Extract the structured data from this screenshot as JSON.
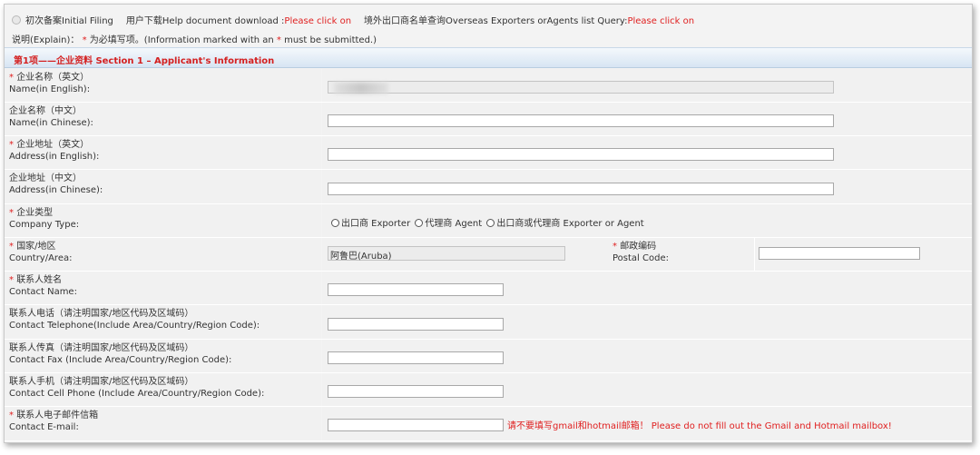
{
  "topbar": {
    "initial_filing": "初次备案Initial Filing",
    "help_label": "用户下载Help document download :",
    "help_link": "Please click on",
    "query_label": "境外出口商名单查询Overseas Exporters orAgents list Query:",
    "query_link": "Please click on"
  },
  "explain": {
    "prefix": "说明(Explain)：",
    "star": "*",
    "mid": "为必填写项。(Information marked with an",
    "star2": "*",
    "suffix": "must be submitted.)"
  },
  "section": {
    "title": "第1项——企业资料 Section 1 – Applicant's Information"
  },
  "fields": {
    "name_en": {
      "required": "*",
      "cn": "企业名称（英文）",
      "en": "Name(in English):"
    },
    "name_cn": {
      "cn": "企业名称（中文）",
      "en": "Name(in Chinese):"
    },
    "addr_en": {
      "required": "*",
      "cn": "企业地址（英文）",
      "en": "Address(in English):"
    },
    "addr_cn": {
      "cn": "企业地址（中文）",
      "en": "Address(in Chinese):"
    },
    "company_type": {
      "required": "*",
      "cn": "企业类型",
      "en": "Company Type:",
      "options": [
        "出口商 Exporter",
        "代理商 Agent",
        "出口商或代理商 Exporter or Agent"
      ]
    },
    "country": {
      "required": "*",
      "cn": "国家/地区",
      "en": "Country/Area:",
      "value": "阿鲁巴(Aruba)"
    },
    "postal": {
      "required": "*",
      "cn": "邮政编码",
      "en": "Postal Code:"
    },
    "contact_name": {
      "required": "*",
      "cn": "联系人姓名",
      "en": "Contact Name:"
    },
    "contact_tel": {
      "cn": "联系人电话（请注明国家/地区代码及区域码）",
      "en": "Contact Telephone(Include Area/Country/Region Code):"
    },
    "contact_fax": {
      "cn": "联系人传真（请注明国家/地区代码及区域码）",
      "en": "Contact Fax (Include Area/Country/Region Code):"
    },
    "contact_cell": {
      "cn": "联系人手机（请注明国家/地区代码及区域码）",
      "en": "Contact Cell Phone (Include Area/Country/Region Code):"
    },
    "contact_email": {
      "required": "*",
      "cn": "联系人电子邮件信箱",
      "en": "Contact E-mail:",
      "warning": "请不要填写gmail和hotmail邮箱！ Please do not fill out the Gmail and Hotmail mailbox!"
    }
  },
  "colors": {
    "required": "#e02020",
    "section_title": "#d42020"
  }
}
